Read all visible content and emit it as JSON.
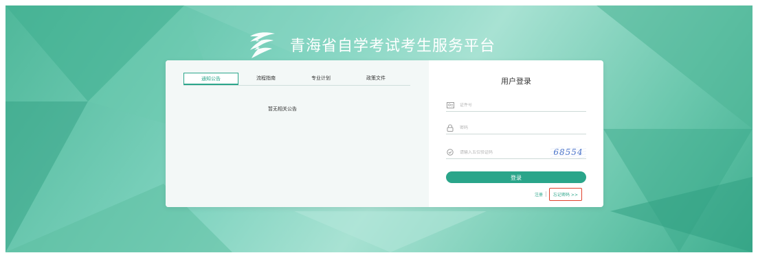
{
  "site": {
    "title": "青海省自学考试考生服务平台"
  },
  "tabs": [
    {
      "label": "通知公告",
      "active": true
    },
    {
      "label": "流程指南",
      "active": false
    },
    {
      "label": "专业计划",
      "active": false
    },
    {
      "label": "政策文件",
      "active": false
    }
  ],
  "notice_empty": "暂无相关公告",
  "login": {
    "title": "用户登录",
    "id_placeholder": "证件号",
    "password_placeholder": "密码",
    "captcha_placeholder": "请输入五位验证码",
    "captcha_code": "68554",
    "submit": "登录",
    "register": "注册",
    "forgot": "忘记密码 >>"
  },
  "colors": {
    "accent": "#2aa58a",
    "highlight_border": "#e0402a"
  },
  "icons": {
    "id": "id-card-icon",
    "password": "lock-icon",
    "captcha": "shield-check-icon",
    "logo": "ribbon-logo-icon"
  }
}
